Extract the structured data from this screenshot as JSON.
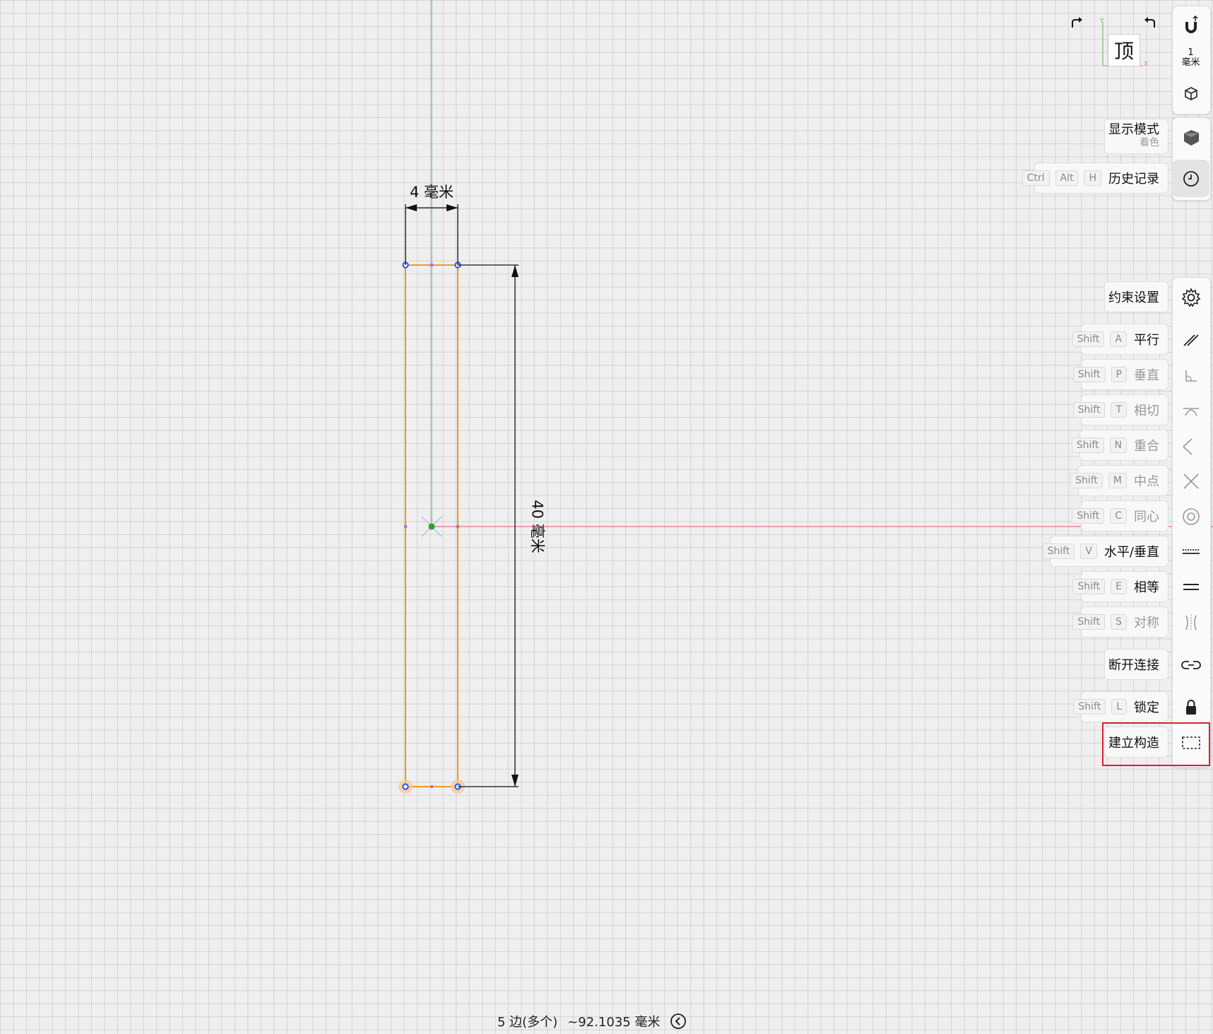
{
  "canvas": {
    "dim_width": "4 毫米",
    "dim_height": "40 毫米"
  },
  "viewcube": {
    "face_label": "顶",
    "axis_y": "Y",
    "axis_x": "X",
    "redo_icon": "redo-arrow",
    "undo_icon": "undo-arrow"
  },
  "toolbar": {
    "unit_value": "1",
    "unit_name": "毫米",
    "display_mode": "显示模式",
    "display_mode_sub": "着色",
    "history": {
      "keys": [
        "Ctrl",
        "Alt",
        "H"
      ],
      "label": "历史记录"
    },
    "constraint_settings": "约束设置",
    "constraints": [
      {
        "keys": [
          "Shift",
          "A"
        ],
        "label": "平行",
        "active": true
      },
      {
        "keys": [
          "Shift",
          "P"
        ],
        "label": "垂直",
        "active": false
      },
      {
        "keys": [
          "Shift",
          "T"
        ],
        "label": "相切",
        "active": false
      },
      {
        "keys": [
          "Shift",
          "N"
        ],
        "label": "重合",
        "active": false
      },
      {
        "keys": [
          "Shift",
          "M"
        ],
        "label": "中点",
        "active": false
      },
      {
        "keys": [
          "Shift",
          "C"
        ],
        "label": "同心",
        "active": false
      },
      {
        "keys": [
          "Shift",
          "V"
        ],
        "label": "水平/垂直",
        "active": true
      },
      {
        "keys": [
          "Shift",
          "E"
        ],
        "label": "相等",
        "active": true
      },
      {
        "keys": [
          "Shift",
          "S"
        ],
        "label": "对称",
        "active": false
      }
    ],
    "disconnect": "断开连接",
    "lock": {
      "keys": [
        "Shift",
        "L"
      ],
      "label": "锁定"
    },
    "construction": "建立构造"
  },
  "status": {
    "selection": "5 边(多个)",
    "length": "~92.1035 毫米"
  },
  "colors": {
    "sketch_line": "#f29a1f",
    "x_axis": "#e07b7b",
    "y_axis": "#62b562",
    "point": "#2255ee",
    "midpoint": "#b36cf0",
    "highlight": "#d9232e"
  }
}
